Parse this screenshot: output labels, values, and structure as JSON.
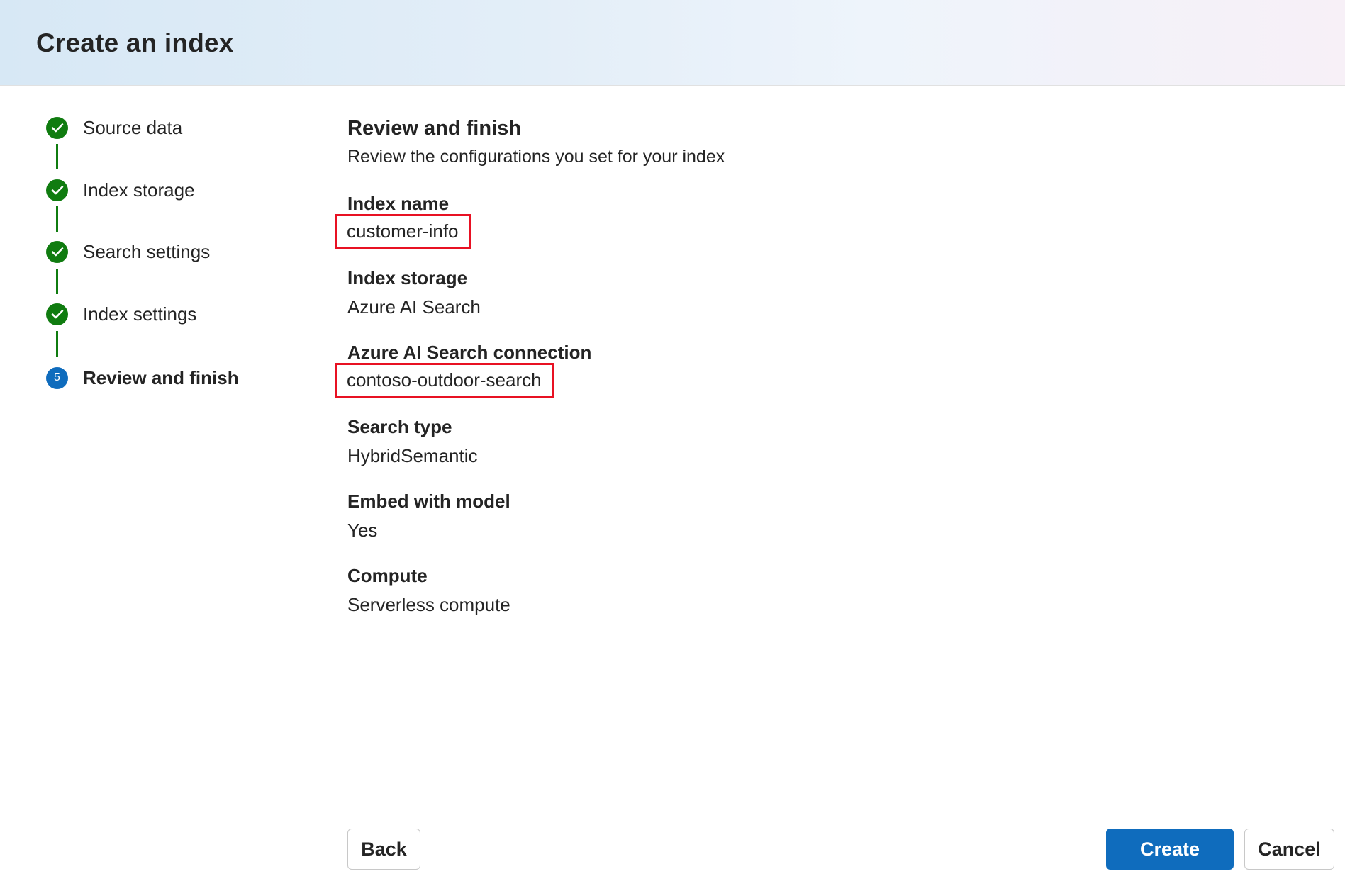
{
  "header": {
    "title": "Create an index"
  },
  "steps": [
    {
      "label": "Source data",
      "status": "complete",
      "icon": "checkmark-circle-icon"
    },
    {
      "label": "Index storage",
      "status": "complete",
      "icon": "checkmark-circle-icon"
    },
    {
      "label": "Search settings",
      "status": "complete",
      "icon": "checkmark-circle-icon"
    },
    {
      "label": "Index settings",
      "status": "complete",
      "icon": "checkmark-circle-icon"
    },
    {
      "label": "Review and finish",
      "status": "current",
      "number": "5"
    }
  ],
  "review": {
    "title": "Review and finish",
    "subtitle": "Review the configurations you set for your index",
    "fields": [
      {
        "label": "Index name",
        "value": "customer-info",
        "highlighted": true
      },
      {
        "label": "Index storage",
        "value": "Azure AI Search",
        "highlighted": false
      },
      {
        "label": "Azure AI Search connection",
        "value": "contoso-outdoor-search",
        "highlighted": true
      },
      {
        "label": "Search type",
        "value": "HybridSemantic",
        "highlighted": false
      },
      {
        "label": "Embed with model",
        "value": "Yes",
        "highlighted": false
      },
      {
        "label": "Compute",
        "value": "Serverless compute",
        "highlighted": false
      }
    ]
  },
  "footer": {
    "back_label": "Back",
    "create_label": "Create",
    "cancel_label": "Cancel"
  },
  "colors": {
    "complete": "#107c10",
    "current": "#0f6cbd",
    "primary_button": "#0f6cbd",
    "highlight": "#e81123"
  }
}
